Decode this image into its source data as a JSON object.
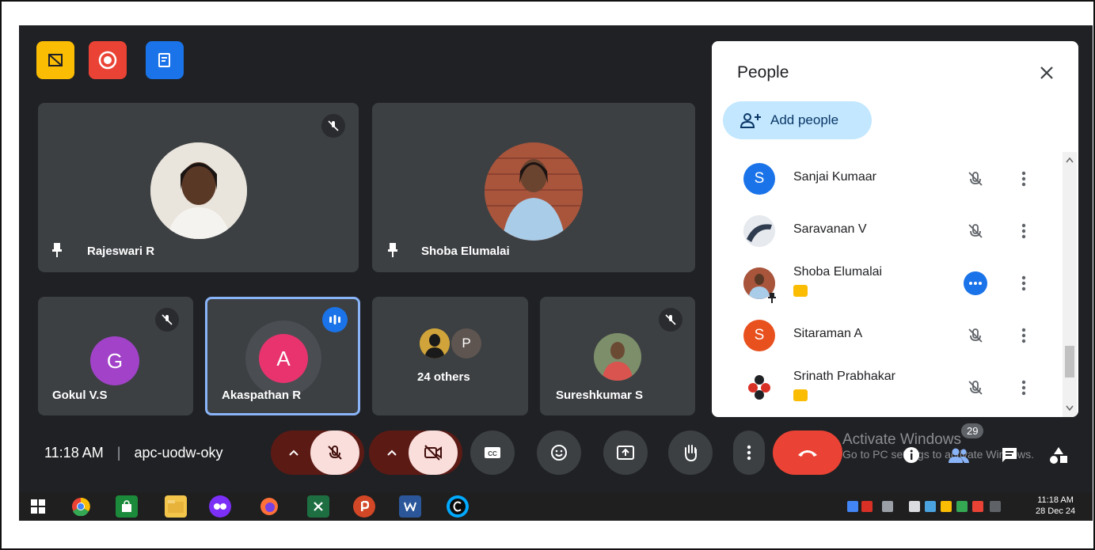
{
  "meeting": {
    "clock": "11:18 AM",
    "separator": "|",
    "meeting_code": "apc-uodw-oky"
  },
  "tiles": {
    "rajeswari": {
      "name": "Rajeswari R"
    },
    "shoba": {
      "name": "Shoba Elumalai"
    },
    "gokul": {
      "name": "Gokul V.S",
      "initial": "G"
    },
    "akaspathan": {
      "name": "Akaspathan R",
      "initial": "A"
    },
    "others": {
      "label": "24 others",
      "initial": "P"
    },
    "sureshkumar": {
      "name": "Sureshkumar S"
    }
  },
  "panel": {
    "title": "People",
    "add_people_label": "Add people",
    "people": [
      {
        "name": "Sanjai Kumaar",
        "initial": "S",
        "color": "#1a73e8"
      },
      {
        "name": "Saravanan V",
        "initial": "",
        "color": "#5f6368"
      },
      {
        "name": "Shoba Elumalai",
        "initial": "",
        "color": "#9a6b4f",
        "presenting": true
      },
      {
        "name": "Sitaraman A",
        "initial": "S",
        "color": "#e8501e"
      },
      {
        "name": "Srinath Prabhakar",
        "initial": "",
        "color": "#ffffff",
        "presenting": true
      }
    ]
  },
  "controls": {
    "participant_count": "29"
  },
  "watermark": {
    "line1": "Activate Windows",
    "line2": "Go to PC settings to activate Windows."
  },
  "taskbar": {
    "time": "11:18 AM",
    "date": "28 Dec 24"
  },
  "colors": {
    "meet_bg": "#202124",
    "tile_bg": "#3c4043",
    "end_call": "#ea4335",
    "active_speaker": "#8ab4f8",
    "add_people_bg": "#c2e7ff"
  }
}
